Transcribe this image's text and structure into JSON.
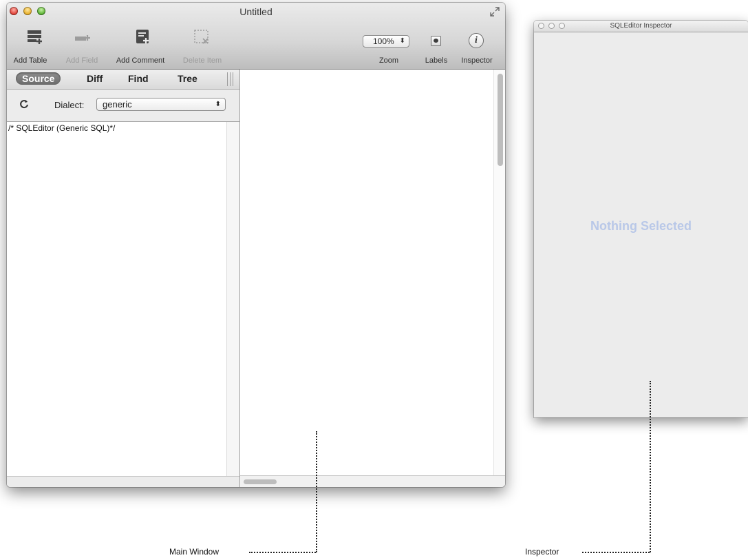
{
  "main_window": {
    "title": "Untitled",
    "toolbar": {
      "add_table": "Add Table",
      "add_field": "Add Field",
      "add_comment": "Add Comment",
      "delete_item": "Delete Item",
      "zoom_value": "100%",
      "zoom_label": "Zoom",
      "labels_label": "Labels",
      "inspector_label": "Inspector"
    },
    "tabs": [
      "Source",
      "Diff",
      "Find",
      "Tree"
    ],
    "active_tab": "Source",
    "dialect_label": "Dialect:",
    "dialect_value": "generic",
    "source_text": "/* SQLEditor (Generic SQL)*/"
  },
  "inspector_window": {
    "title": "SQLEditor Inspector",
    "empty_message": "Nothing Selected"
  },
  "annotations": {
    "main_window": "Main Window",
    "inspector": "Inspector"
  },
  "colors": {
    "empty_message": "#b9c8e8",
    "active_tab_bg": "#7a7a7a"
  }
}
